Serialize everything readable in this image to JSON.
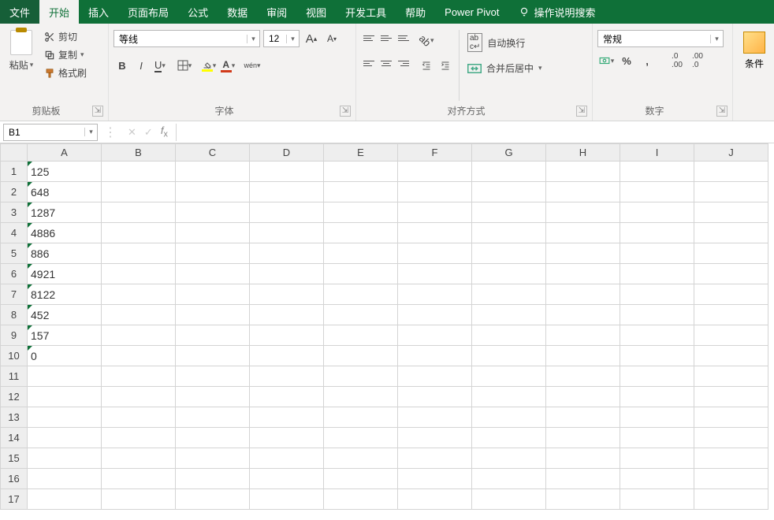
{
  "menubar": {
    "file": "文件",
    "tabs": [
      "开始",
      "插入",
      "页面布局",
      "公式",
      "数据",
      "审阅",
      "视图",
      "开发工具",
      "帮助",
      "Power Pivot"
    ],
    "active_index": 0,
    "tell_me": "操作说明搜索"
  },
  "ribbon": {
    "clipboard": {
      "paste": "粘贴",
      "cut": "剪切",
      "copy": "复制",
      "format_painter": "格式刷",
      "label": "剪贴板"
    },
    "font": {
      "name": "等线",
      "size": "12",
      "label": "字体",
      "pinyin_btn": "wén"
    },
    "alignment": {
      "wrap": "自动换行",
      "merge": "合并后居中",
      "label": "对齐方式"
    },
    "number": {
      "format": "常规",
      "percent": "%",
      "comma": ",",
      "label": "数字"
    },
    "styles": {
      "cond": "条件"
    }
  },
  "formula_bar": {
    "name_box": "B1",
    "fx_value": ""
  },
  "grid": {
    "columns": [
      "A",
      "B",
      "C",
      "D",
      "E",
      "F",
      "G",
      "H",
      "I",
      "J"
    ],
    "rows": [
      {
        "n": "1",
        "A": "125"
      },
      {
        "n": "2",
        "A": "648"
      },
      {
        "n": "3",
        "A": "1287"
      },
      {
        "n": "4",
        "A": "4886"
      },
      {
        "n": "5",
        "A": "886"
      },
      {
        "n": "6",
        "A": "4921"
      },
      {
        "n": "7",
        "A": "8122"
      },
      {
        "n": "8",
        "A": "452"
      },
      {
        "n": "9",
        "A": "157"
      },
      {
        "n": "10",
        "A": "0"
      },
      {
        "n": "11",
        "A": ""
      },
      {
        "n": "12",
        "A": ""
      },
      {
        "n": "13",
        "A": ""
      },
      {
        "n": "14",
        "A": ""
      },
      {
        "n": "15",
        "A": ""
      },
      {
        "n": "16",
        "A": ""
      },
      {
        "n": "17",
        "A": ""
      }
    ]
  }
}
